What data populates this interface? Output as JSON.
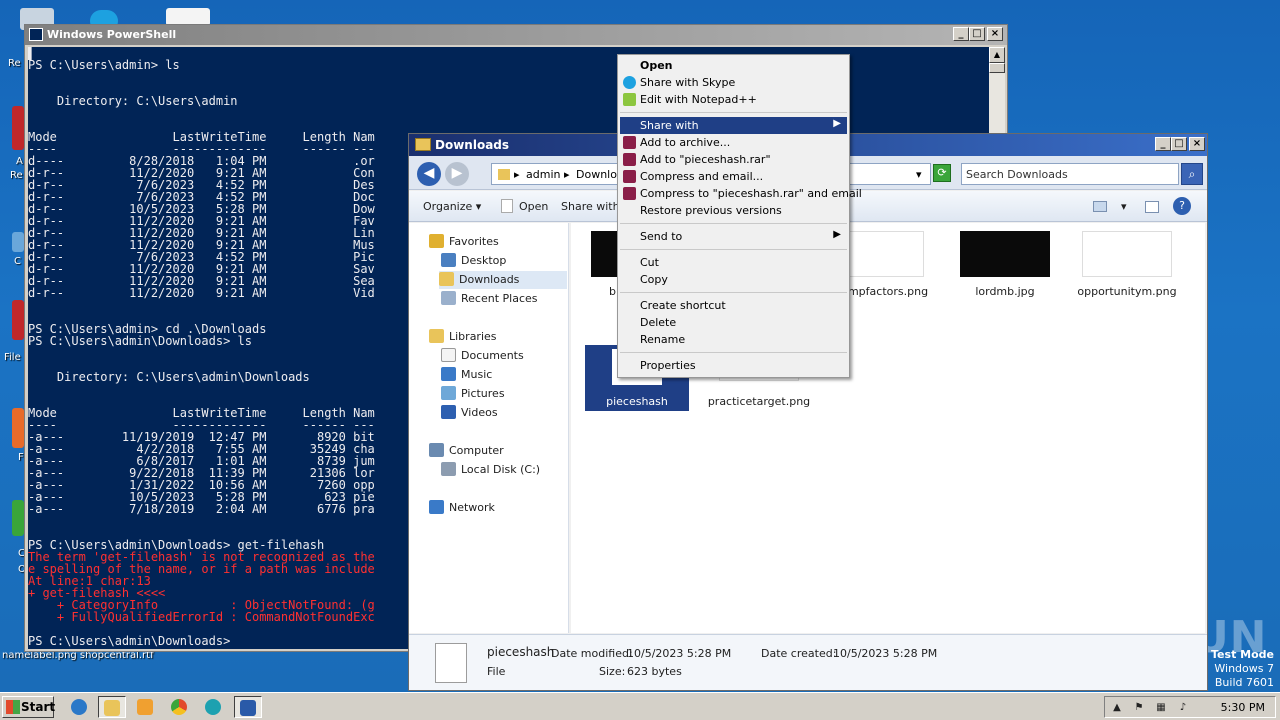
{
  "desktop": {
    "labels": {
      "l1": "Re",
      "l2": "A",
      "l3": "Re",
      "l4": "C",
      "l5": "File",
      "l6": "F",
      "l7": "C",
      "l8": "O",
      "l9": "namelabel.png  shopcentral.rtf"
    },
    "watermark": "ANY RUN",
    "testmode": {
      "line1": "Test Mode",
      "line2": "Windows 7",
      "line3": "Build 7601"
    }
  },
  "powershell": {
    "title": "Windows PowerShell",
    "lines": [
      {
        "text": "▌",
        "err": false
      },
      {
        "text": "PS C:\\Users\\admin> ls",
        "err": false
      },
      {
        "text": "",
        "err": false
      },
      {
        "text": "",
        "err": false
      },
      {
        "text": "    Directory: C:\\Users\\admin",
        "err": false
      },
      {
        "text": "",
        "err": false
      },
      {
        "text": "",
        "err": false
      },
      {
        "text": "Mode                LastWriteTime     Length Nam",
        "err": false
      },
      {
        "text": "----                -------------     ------ ---",
        "err": false
      },
      {
        "text": "d----         8/28/2018   1:04 PM            .or",
        "err": false
      },
      {
        "text": "d-r--         11/2/2020   9:21 AM            Con",
        "err": false
      },
      {
        "text": "d-r--          7/6/2023   4:52 PM            Des",
        "err": false
      },
      {
        "text": "d-r--          7/6/2023   4:52 PM            Doc",
        "err": false
      },
      {
        "text": "d-r--         10/5/2023   5:28 PM            Dow",
        "err": false
      },
      {
        "text": "d-r--         11/2/2020   9:21 AM            Fav",
        "err": false
      },
      {
        "text": "d-r--         11/2/2020   9:21 AM            Lin",
        "err": false
      },
      {
        "text": "d-r--         11/2/2020   9:21 AM            Mus",
        "err": false
      },
      {
        "text": "d-r--          7/6/2023   4:52 PM            Pic",
        "err": false
      },
      {
        "text": "d-r--         11/2/2020   9:21 AM            Sav",
        "err": false
      },
      {
        "text": "d-r--         11/2/2020   9:21 AM            Sea",
        "err": false
      },
      {
        "text": "d-r--         11/2/2020   9:21 AM            Vid",
        "err": false
      },
      {
        "text": "",
        "err": false
      },
      {
        "text": "",
        "err": false
      },
      {
        "text": "PS C:\\Users\\admin> cd .\\Downloads",
        "err": false
      },
      {
        "text": "PS C:\\Users\\admin\\Downloads> ls",
        "err": false
      },
      {
        "text": "",
        "err": false
      },
      {
        "text": "",
        "err": false
      },
      {
        "text": "    Directory: C:\\Users\\admin\\Downloads",
        "err": false
      },
      {
        "text": "",
        "err": false
      },
      {
        "text": "",
        "err": false
      },
      {
        "text": "Mode                LastWriteTime     Length Nam",
        "err": false
      },
      {
        "text": "----                -------------     ------ ---",
        "err": false
      },
      {
        "text": "-a---        11/19/2019  12:47 PM       8920 bit",
        "err": false
      },
      {
        "text": "-a---          4/2/2018   7:55 AM      35249 cha",
        "err": false
      },
      {
        "text": "-a---          6/8/2017   1:01 AM       8739 jum",
        "err": false
      },
      {
        "text": "-a---         9/22/2018  11:39 PM      21306 lor",
        "err": false
      },
      {
        "text": "-a---         1/31/2022  10:56 AM       7260 opp",
        "err": false
      },
      {
        "text": "-a---         10/5/2023   5:28 PM        623 pie",
        "err": false
      },
      {
        "text": "-a---         7/18/2019   2:04 AM       6776 pra",
        "err": false
      },
      {
        "text": "",
        "err": false
      },
      {
        "text": "",
        "err": false
      },
      {
        "text": "PS C:\\Users\\admin\\Downloads> get-filehash",
        "err": false
      },
      {
        "text": "The term 'get-filehash' is not recognized as the",
        "err": true
      },
      {
        "text": "e spelling of the name, or if a path was include",
        "err": true
      },
      {
        "text": "At line:1 char:13",
        "err": true
      },
      {
        "text": "+ get-filehash <<<<",
        "err": true
      },
      {
        "text": "    + CategoryInfo          : ObjectNotFound: (g",
        "err": true
      },
      {
        "text": "    + FullyQualifiedErrorId : CommandNotFoundExc",
        "err": true
      },
      {
        "text": "",
        "err": false
      },
      {
        "text": "PS C:\\Users\\admin\\Downloads>",
        "err": false
      }
    ]
  },
  "explorer": {
    "title": "Downloads",
    "address": {
      "seg1": "admin",
      "seg2": "Downloads"
    },
    "search_placeholder": "Search Downloads",
    "toolbar": {
      "organize": "Organize",
      "open": "Open",
      "share": "Share with"
    },
    "nav": {
      "favorites": "Favorites",
      "desktop": "Desktop",
      "downloads": "Downloads",
      "recent": "Recent Places",
      "libraries": "Libraries",
      "documents": "Documents",
      "music": "Music",
      "pictures": "Pictures",
      "videos": "Videos",
      "computer": "Computer",
      "localdisk": "Local Disk (C:)",
      "network": "Network"
    },
    "files": {
      "f1": "b",
      "f2": "jumpfactors.png",
      "f3": "lordmb.jpg",
      "f4": "opportunitym.png",
      "f5": "pieceshash",
      "f6": "practicetarget.png"
    },
    "status": {
      "name": "pieceshash",
      "type": "File",
      "modified_label": "Date modified:",
      "modified": "10/5/2023 5:28 PM",
      "created_label": "Date created:",
      "created": "10/5/2023 5:28 PM",
      "size_label": "Size:",
      "size": "623 bytes"
    }
  },
  "context_menu": {
    "open": "Open",
    "skype": "Share with Skype",
    "notepad": "Edit with Notepad++",
    "share_with": "Share with",
    "add_archive": "Add to archive...",
    "add_rar": "Add to \"pieceshash.rar\"",
    "compress_email": "Compress and email...",
    "compress_rar_email": "Compress to \"pieceshash.rar\" and email",
    "restore": "Restore previous versions",
    "send_to": "Send to",
    "cut": "Cut",
    "copy": "Copy",
    "create_shortcut": "Create shortcut",
    "delete": "Delete",
    "rename": "Rename",
    "properties": "Properties"
  },
  "taskbar": {
    "start": "Start",
    "clock": "5:30 PM"
  },
  "colors": {
    "console_bg": "#012456",
    "error": "#ff3030",
    "selection": "#1f3f86"
  }
}
